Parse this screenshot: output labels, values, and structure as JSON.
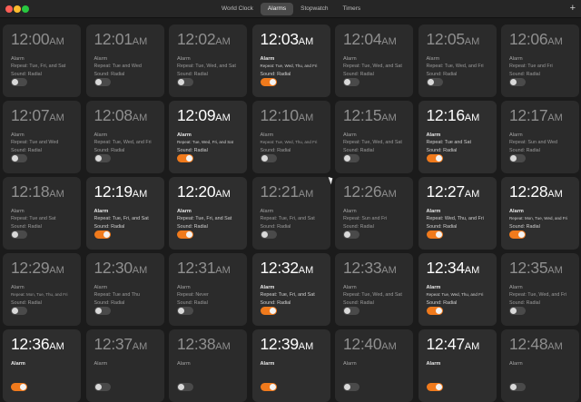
{
  "window": {
    "tabs": [
      {
        "label": "World Clock"
      },
      {
        "label": "Alarms"
      },
      {
        "label": "Stopwatch"
      },
      {
        "label": "Timers"
      }
    ],
    "active_tab": "Alarms",
    "add_icon": "plus-icon"
  },
  "accent_color": "#f07a1c",
  "alarms": [
    {
      "time": "12:00",
      "ampm": "AM",
      "label": "Alarm",
      "repeat": "Repeat: Tue, Fri, and Sat",
      "sound": "Sound: Radial",
      "enabled": false
    },
    {
      "time": "12:01",
      "ampm": "AM",
      "label": "Alarm",
      "repeat": "Repeat: Tue and Wed",
      "sound": "Sound: Radial",
      "enabled": false
    },
    {
      "time": "12:02",
      "ampm": "AM",
      "label": "Alarm",
      "repeat": "Repeat: Tue, Wed, and Sat",
      "sound": "Sound: Radial",
      "enabled": false
    },
    {
      "time": "12:03",
      "ampm": "AM",
      "label": "Alarm",
      "repeat": "Repeat: Tue, Wed, Thu, and Fri",
      "sound": "Sound: Radial",
      "enabled": true
    },
    {
      "time": "12:04",
      "ampm": "AM",
      "label": "Alarm",
      "repeat": "Repeat: Tue, Wed, and Sat",
      "sound": "Sound: Radial",
      "enabled": false
    },
    {
      "time": "12:05",
      "ampm": "AM",
      "label": "Alarm",
      "repeat": "Repeat: Tue, Wed, and Fri",
      "sound": "Sound: Radial",
      "enabled": false
    },
    {
      "time": "12:06",
      "ampm": "AM",
      "label": "Alarm",
      "repeat": "Repeat: Tue and Fri",
      "sound": "Sound: Radial",
      "enabled": false
    },
    {
      "time": "12:07",
      "ampm": "AM",
      "label": "Alarm",
      "repeat": "Repeat: Tue and Wed",
      "sound": "Sound: Radial",
      "enabled": false
    },
    {
      "time": "12:08",
      "ampm": "AM",
      "label": "Alarm",
      "repeat": "Repeat: Tue, Wed, and Fri",
      "sound": "Sound: Radial",
      "enabled": false
    },
    {
      "time": "12:09",
      "ampm": "AM",
      "label": "Alarm",
      "repeat": "Repeat: Tue, Wed, Fri, and Sat",
      "sound": "Sound: Radial",
      "enabled": true
    },
    {
      "time": "12:10",
      "ampm": "AM",
      "label": "Alarm",
      "repeat": "Repeat: Tue, Wed, Thu, and Fri",
      "sound": "Sound: Radial",
      "enabled": false
    },
    {
      "time": "12:15",
      "ampm": "AM",
      "label": "Alarm",
      "repeat": "Repeat: Tue, Wed, and Sat",
      "sound": "Sound: Radial",
      "enabled": false
    },
    {
      "time": "12:16",
      "ampm": "AM",
      "label": "Alarm",
      "repeat": "Repeat: Tue and Sat",
      "sound": "Sound: Radial",
      "enabled": true
    },
    {
      "time": "12:17",
      "ampm": "AM",
      "label": "Alarm",
      "repeat": "Repeat: Sun and Wed",
      "sound": "Sound: Radial",
      "enabled": false
    },
    {
      "time": "12:18",
      "ampm": "AM",
      "label": "Alarm",
      "repeat": "Repeat: Tue and Sat",
      "sound": "Sound: Radial",
      "enabled": false
    },
    {
      "time": "12:19",
      "ampm": "AM",
      "label": "Alarm",
      "repeat": "Repeat: Tue, Fri, and Sat",
      "sound": "Sound: Radial",
      "enabled": true
    },
    {
      "time": "12:20",
      "ampm": "AM",
      "label": "Alarm",
      "repeat": "Repeat: Tue, Fri, and Sat",
      "sound": "Sound: Radial",
      "enabled": true
    },
    {
      "time": "12:21",
      "ampm": "AM",
      "label": "Alarm",
      "repeat": "Repeat: Tue, Fri, and Sat",
      "sound": "Sound: Radial",
      "enabled": false
    },
    {
      "time": "12:26",
      "ampm": "AM",
      "label": "Alarm",
      "repeat": "Repeat: Sun and Fri",
      "sound": "Sound: Radial",
      "enabled": false
    },
    {
      "time": "12:27",
      "ampm": "AM",
      "label": "Alarm",
      "repeat": "Repeat: Wed, Thu, and Fri",
      "sound": "Sound: Radial",
      "enabled": true
    },
    {
      "time": "12:28",
      "ampm": "AM",
      "label": "Alarm",
      "repeat": "Repeat: Mon, Tue, Wed, and Fri",
      "sound": "Sound: Radial",
      "enabled": true
    },
    {
      "time": "12:29",
      "ampm": "AM",
      "label": "Alarm",
      "repeat": "Repeat: Mon, Tue, Thu, and Fri",
      "sound": "Sound: Radial",
      "enabled": false
    },
    {
      "time": "12:30",
      "ampm": "AM",
      "label": "Alarm",
      "repeat": "Repeat: Tue and Thu",
      "sound": "Sound: Radial",
      "enabled": false
    },
    {
      "time": "12:31",
      "ampm": "AM",
      "label": "Alarm",
      "repeat": "Repeat: Never",
      "sound": "Sound: Radial",
      "enabled": false
    },
    {
      "time": "12:32",
      "ampm": "AM",
      "label": "Alarm",
      "repeat": "Repeat: Tue, Fri, and Sat",
      "sound": "Sound: Radial",
      "enabled": true
    },
    {
      "time": "12:33",
      "ampm": "AM",
      "label": "Alarm",
      "repeat": "Repeat: Tue, Wed, and Sat",
      "sound": "Sound: Radial",
      "enabled": false
    },
    {
      "time": "12:34",
      "ampm": "AM",
      "label": "Alarm",
      "repeat": "Repeat: Tue, Wed, Thu, and Fri",
      "sound": "Sound: Radial",
      "enabled": true
    },
    {
      "time": "12:35",
      "ampm": "AM",
      "label": "Alarm",
      "repeat": "Repeat: Tue, Wed, and Fri",
      "sound": "Sound: Radial",
      "enabled": false
    },
    {
      "time": "12:36",
      "ampm": "AM",
      "label": "Alarm",
      "repeat": "",
      "sound": "",
      "enabled": true
    },
    {
      "time": "12:37",
      "ampm": "AM",
      "label": "Alarm",
      "repeat": "",
      "sound": "",
      "enabled": false
    },
    {
      "time": "12:38",
      "ampm": "AM",
      "label": "Alarm",
      "repeat": "",
      "sound": "",
      "enabled": false
    },
    {
      "time": "12:39",
      "ampm": "AM",
      "label": "Alarm",
      "repeat": "",
      "sound": "",
      "enabled": true
    },
    {
      "time": "12:40",
      "ampm": "AM",
      "label": "Alarm",
      "repeat": "",
      "sound": "",
      "enabled": false
    },
    {
      "time": "12:47",
      "ampm": "AM",
      "label": "Alarm",
      "repeat": "",
      "sound": "",
      "enabled": true
    },
    {
      "time": "12:48",
      "ampm": "AM",
      "label": "Alarm",
      "repeat": "",
      "sound": "",
      "enabled": false
    }
  ]
}
